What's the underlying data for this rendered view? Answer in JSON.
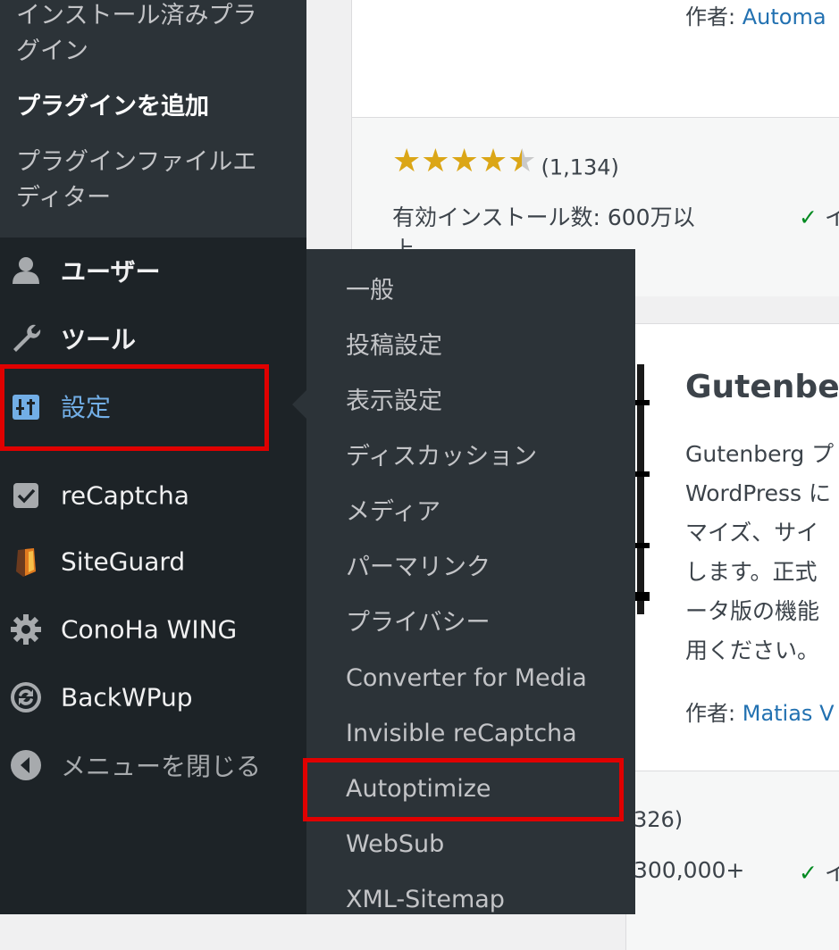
{
  "sidebar": {
    "plugin_submenu": [
      {
        "label_line1": "インストール済みプラ",
        "label_line2": "グイン"
      },
      {
        "label": "プラグインを追加"
      },
      {
        "label_line1": "プラグインファイルエ",
        "label_line2": "ディター"
      }
    ],
    "menu": [
      {
        "label": "ユーザー",
        "icon": "users-icon"
      },
      {
        "label": "ツール",
        "icon": "wrench-icon"
      },
      {
        "label": "設定",
        "icon": "settings-icon"
      },
      {
        "label": "reCaptcha",
        "icon": "checkbox-icon"
      },
      {
        "label": "SiteGuard",
        "icon": "shield-icon"
      },
      {
        "label": "ConoHa WING",
        "icon": "gear-icon"
      },
      {
        "label": "BackWPup",
        "icon": "backup-icon"
      },
      {
        "label": "メニューを閉じる",
        "icon": "collapse-icon"
      }
    ]
  },
  "flyout": {
    "items": [
      "一般",
      "投稿設定",
      "表示設定",
      "ディスカッション",
      "メディア",
      "パーマリンク",
      "プライバシー",
      "Converter for Media",
      "Invisible reCaptcha",
      "Autoptimize",
      "WebSub",
      "XML-Sitemap"
    ]
  },
  "plugins": {
    "card1": {
      "author_label": "作者:",
      "author_name": "Automa",
      "rating_count": "(1,134)",
      "installs_label": "有効インストール数: 600万以",
      "installs_line2": "上",
      "compat_check": "✓",
      "compat_text": "イ"
    },
    "card2": {
      "name": "Gutenberg",
      "desc": [
        "Gutenberg プ",
        "WordPress に",
        "マイズ、サイ",
        "します。正式",
        "ータ版の機能",
        "用ください。"
      ],
      "author_label": "作者:",
      "author_name": "Matias V",
      "rating_count": "326)",
      "installs": "300,000+",
      "compat_check": "✓",
      "compat_text": "イ"
    }
  },
  "colors": {
    "highlight": "#e00000",
    "sidebar_bg": "#1d2327",
    "submenu_bg": "#2c3338",
    "link": "#2271b1",
    "star": "#dba617"
  }
}
